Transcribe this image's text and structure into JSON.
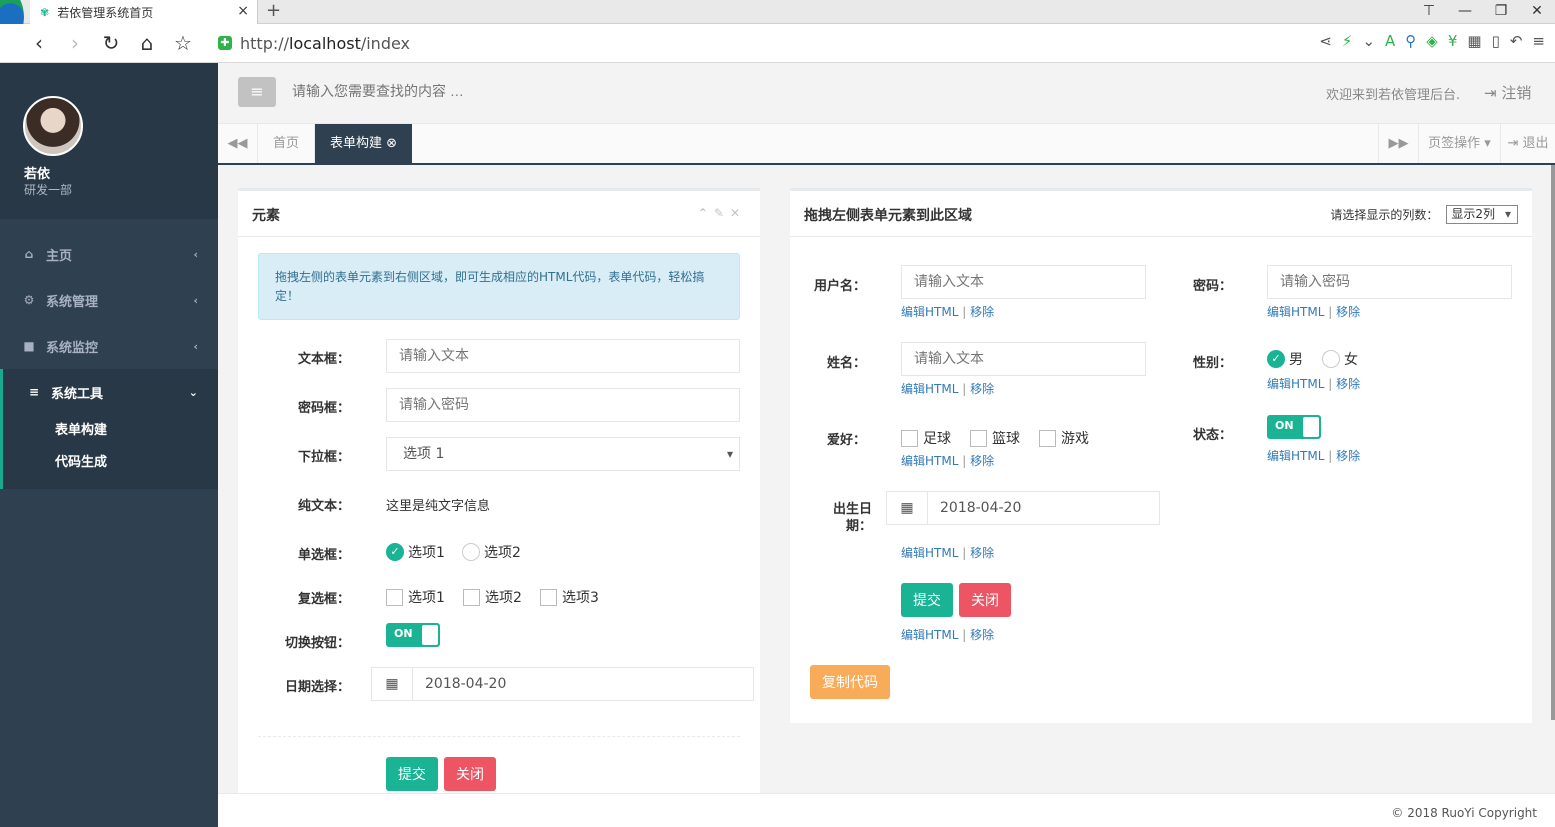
{
  "browser": {
    "tab_title": "若依管理系统首页",
    "url_scheme": "http://",
    "url_host": "localhost",
    "url_path": "/index"
  },
  "sidebar": {
    "user_name": "若依",
    "user_dept": "研发一部",
    "items": [
      {
        "label": "主页",
        "icon": "home-icon"
      },
      {
        "label": "系统管理",
        "icon": "gear-icon"
      },
      {
        "label": "系统监控",
        "icon": "video-icon"
      },
      {
        "label": "系统工具",
        "icon": "bars-icon"
      }
    ],
    "subitems": [
      "表单构建",
      "代码生成"
    ]
  },
  "header": {
    "search_placeholder": "请输入您需要查找的内容 …",
    "welcome": "欢迎来到若依管理后台.",
    "logout": "注销"
  },
  "tabs": {
    "home": "首页",
    "active": "表单构建",
    "page_ops": "页签操作",
    "exit": "退出"
  },
  "left_panel": {
    "title": "元素",
    "alert": "拖拽左侧的表单元素到右侧区域，即可生成相应的HTML代码，表单代码，轻松搞定！",
    "fields": {
      "text_label": "文本框：",
      "text_placeholder": "请输入文本",
      "password_label": "密码框：",
      "password_placeholder": "请输入密码",
      "select_label": "下拉框：",
      "select_value": "选项 1",
      "plain_label": "纯文本：",
      "plain_value": "这里是纯文字信息",
      "radio_label": "单选框：",
      "radio_options": [
        "选项1",
        "选项2"
      ],
      "checkbox_label": "复选框：",
      "checkbox_options": [
        "选项1",
        "选项2",
        "选项3"
      ],
      "switch_label": "切换按钮：",
      "switch_text": "ON",
      "date_label": "日期选择：",
      "date_value": "2018-04-20"
    },
    "submit": "提交",
    "close": "关闭"
  },
  "right_panel": {
    "title": "拖拽左侧表单元素到此区域",
    "columns_label": "请选择显示的列数：",
    "columns_value": "显示2列",
    "username_label": "用户名：",
    "username_placeholder": "请输入文本",
    "password_label": "密码：",
    "password_placeholder": "请输入密码",
    "name_label": "姓名：",
    "name_placeholder": "请输入文本",
    "gender_label": "性别：",
    "gender_options": [
      "男",
      "女"
    ],
    "hobby_label": "爱好：",
    "hobby_options": [
      "足球",
      "篮球",
      "游戏"
    ],
    "status_label": "状态：",
    "status_text": "ON",
    "birth_label": "出生日期：",
    "birth_value": "2018-04-20",
    "edit_html": "编辑HTML",
    "sep": "|",
    "remove": "移除",
    "submit": "提交",
    "close": "关闭",
    "copy_code": "复制代码"
  },
  "footer": {
    "copyright": "© 2018 RuoYi Copyright"
  }
}
